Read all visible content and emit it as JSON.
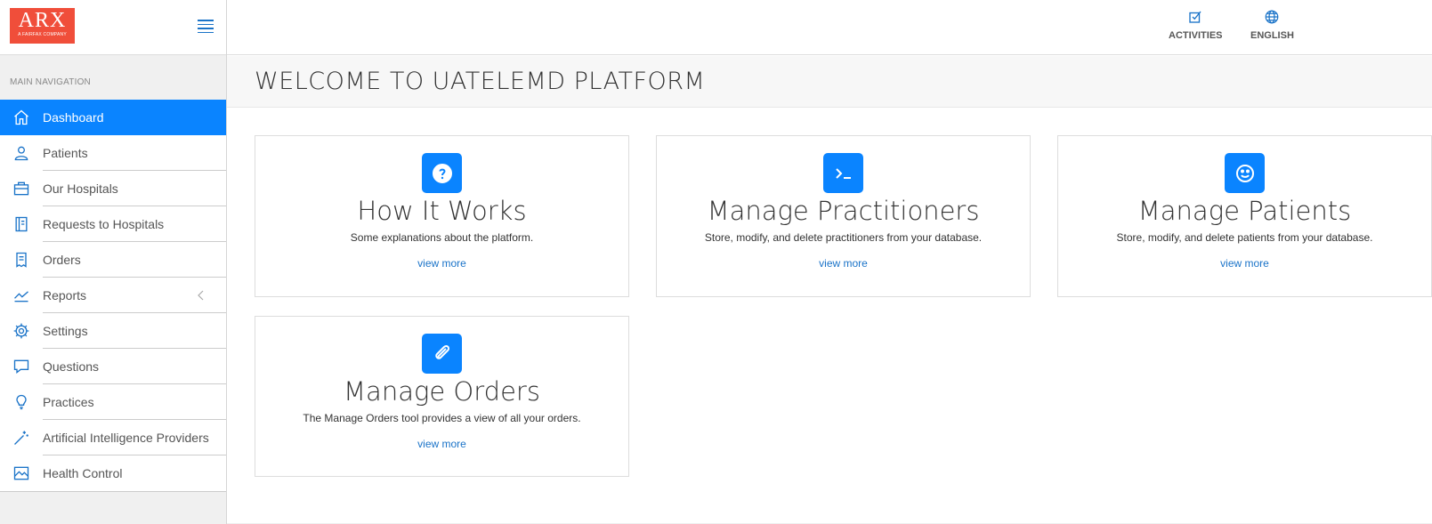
{
  "logo": {
    "main": "ARX",
    "sub": "A FAIRFAX COMPANY"
  },
  "nav": {
    "header": "MAIN NAVIGATION",
    "items": [
      {
        "label": "Dashboard",
        "icon": "home-icon"
      },
      {
        "label": "Patients",
        "icon": "user-icon"
      },
      {
        "label": "Our Hospitals",
        "icon": "briefcase-icon"
      },
      {
        "label": "Requests to Hospitals",
        "icon": "notebook-icon"
      },
      {
        "label": "Orders",
        "icon": "receipt-icon"
      },
      {
        "label": "Reports",
        "icon": "chart-icon"
      },
      {
        "label": "Settings",
        "icon": "gear-icon"
      },
      {
        "label": "Questions",
        "icon": "chat-icon"
      },
      {
        "label": "Practices",
        "icon": "bulb-icon"
      },
      {
        "label": "Artificial Intelligence Providers",
        "icon": "wand-icon"
      },
      {
        "label": "Health Control",
        "icon": "image-icon"
      }
    ]
  },
  "topbar": {
    "activities": "ACTIVITIES",
    "language": "ENGLISH"
  },
  "page": {
    "title": "WELCOME TO UATELEMD PLATFORM"
  },
  "cards": [
    {
      "title": "How It Works",
      "desc": "Some explanations about the platform.",
      "link": "view more",
      "icon": "question-icon"
    },
    {
      "title": "Manage Practitioners",
      "desc": "Store, modify, and delete practitioners from your database.",
      "link": "view more",
      "icon": "terminal-icon"
    },
    {
      "title": "Manage Patients",
      "desc": "Store, modify, and delete patients from your database.",
      "link": "view more",
      "icon": "smile-icon"
    },
    {
      "title": "Manage Orders",
      "desc": "The Manage Orders tool provides a view of all your orders.",
      "link": "view more",
      "icon": "paperclip-icon"
    }
  ],
  "colors": {
    "accent": "#0a84ff",
    "logo": "#f04e3a"
  }
}
